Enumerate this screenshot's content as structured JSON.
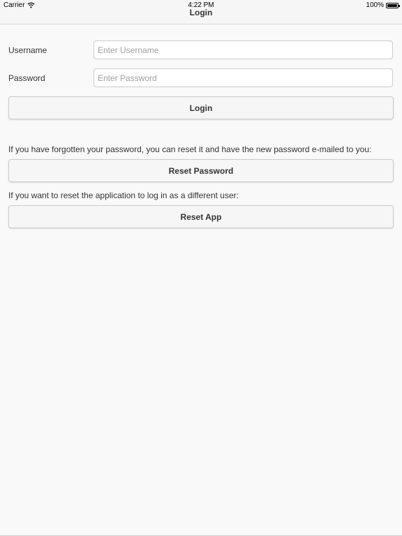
{
  "status_bar": {
    "carrier": "Carrier",
    "time": "4:22 PM",
    "battery": "100%",
    "battery_level": 1.0
  },
  "header": {
    "title": "Login"
  },
  "login_form": {
    "username_label": "Username",
    "username_placeholder": "Enter Username",
    "username_value": "",
    "password_label": "Password",
    "password_placeholder": "Enter Password",
    "password_value": "",
    "login_button": "Login"
  },
  "reset_password": {
    "info": "If you have forgotten your password, you can reset it and have the new password e-mailed to you:",
    "button": "Reset Password"
  },
  "reset_app": {
    "info": "If you want to reset the application to log in as a different user:",
    "button": "Reset App"
  },
  "colors": {
    "background": "#f9f9f9",
    "header_bg": "#f6f6f6",
    "text": "#333333",
    "placeholder": "#9e9e9e",
    "border": "#cccccc"
  },
  "icons": {
    "wifi": "wifi-icon",
    "battery": "battery-icon"
  }
}
